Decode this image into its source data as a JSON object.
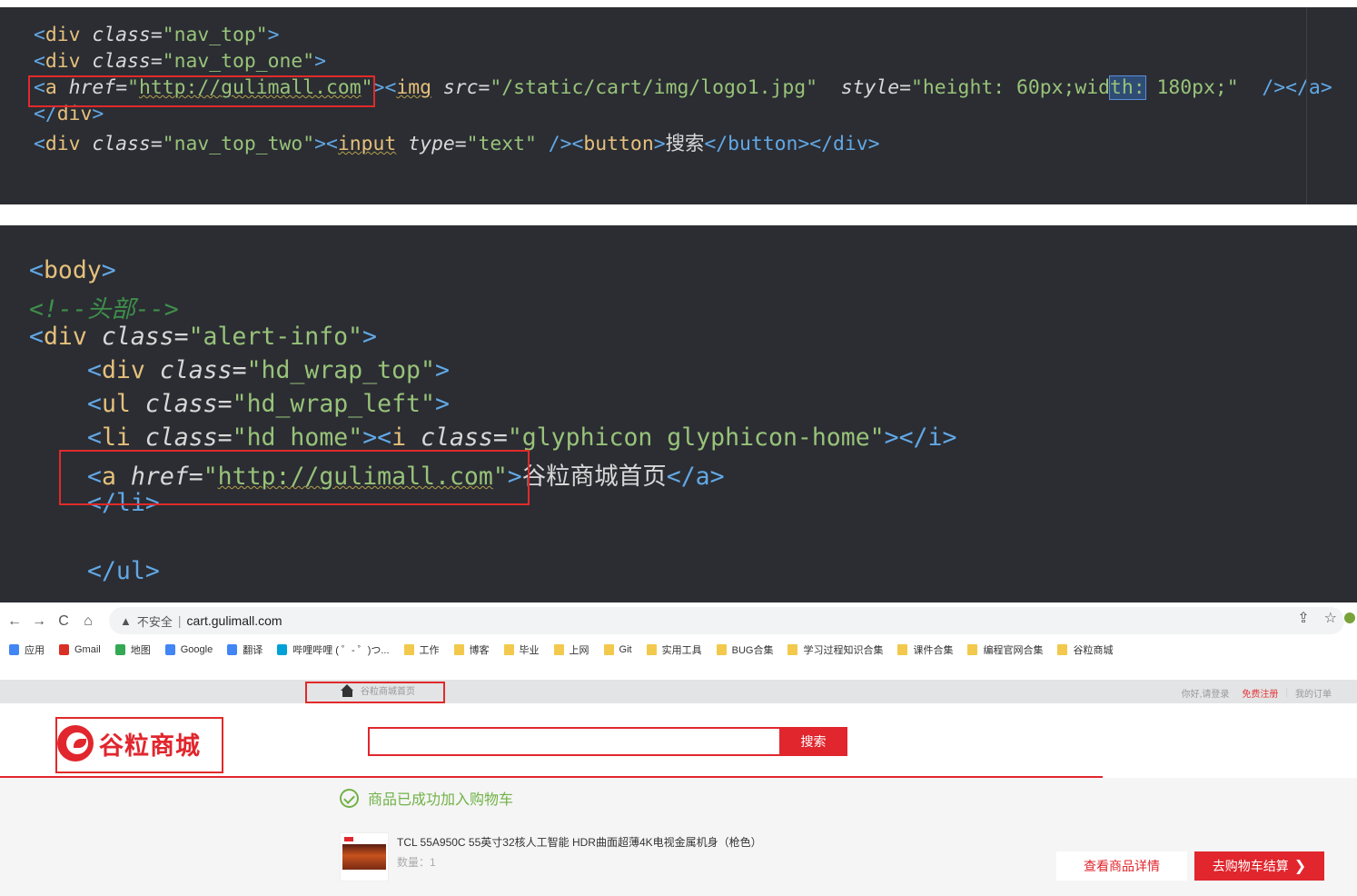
{
  "editor1": {
    "l1": {
      "t1": "<",
      "tag": "div",
      "attr": "class",
      "eq": "=",
      "val": "\"nav_top\"",
      "t2": ">"
    },
    "l2": {
      "t1": "<",
      "tag": "div",
      "attr": "class",
      "eq": "=",
      "val": "\"nav_top_one\"",
      "t2": ">"
    },
    "l3": {
      "t1": "<",
      "tag_a": "a",
      "attr_href": "href",
      "eq": "=",
      "q1": "\"",
      "url": "http://gulimall.com",
      "q2": "\"",
      "gt": ">",
      "lt2": "<",
      "tag_img": "img",
      "attr_src": "src",
      "src_val": "\"/static/cart/img/logo1.jpg\"",
      "attr_style": "style",
      "style_a": "\"height: 60px;wid",
      "style_hl": "th:",
      "style_b": " 180px;\"",
      "close": "/></a>"
    },
    "l4": {
      "t1": "</",
      "tag": "div",
      "t2": ">"
    },
    "l5": {
      "t1": "<",
      "tag": "div",
      "attr": "class",
      "eq": "=",
      "val": "\"nav_top_two\"",
      "t2": ">",
      "lt2": "<",
      "tag_input": "input",
      "attr_type": "type",
      "type_val": "\"text\"",
      "mid": " /><",
      "tag_button": "button",
      "gt": ">",
      "btn_text": "搜索",
      "close_button": "</button></div>"
    }
  },
  "editor2": {
    "l1": {
      "t1": "<",
      "tag": "body",
      "t2": ">"
    },
    "l2": {
      "comment": "<!--头部-->"
    },
    "l3": {
      "t1": "<",
      "tag": "div",
      "attr": "class",
      "eq": "=",
      "val": "\"alert-info\"",
      "t2": ">"
    },
    "l4": {
      "t1": "<",
      "tag": "div",
      "attr": "class",
      "eq": "=",
      "val": "\"hd_wrap_top\"",
      "t2": ">"
    },
    "l5": {
      "t1": "<",
      "tag": "ul",
      "attr": "class",
      "eq": "=",
      "val": "\"hd_wrap_left\"",
      "t2": ">"
    },
    "l6": {
      "t1": "<",
      "tag": "li",
      "attr": "class",
      "eq": "=",
      "val": "\"hd_home\"",
      "t2": "><",
      "tag_i": "i",
      "attr_i": "class",
      "val_i": "\"glyphicon glyphicon-home\"",
      "close_i": "></i>"
    },
    "l7": {
      "t1": "<",
      "tag": "a",
      "attr": "href",
      "eq": "=",
      "q1": "\"",
      "url": "http://gulimall.com",
      "q2": "\"",
      "gt": ">",
      "text": "谷粒商城首页",
      "close": "</a>"
    },
    "l8": {
      "close": "</li>"
    },
    "l9": {
      "close": "</ul>"
    }
  },
  "browser": {
    "nav": {
      "back": "←",
      "forward": "→",
      "reload": "C",
      "home": "⌂"
    },
    "address": {
      "warning": "▲",
      "insecure": "不安全",
      "sep": "|",
      "url": "cart.gulimall.com"
    },
    "actions": {
      "share": "⇪",
      "star": "☆"
    },
    "bookmarks": [
      "应用",
      "Gmail",
      "地图",
      "Google",
      "翻译",
      "哔哩哔哩 ( ゜- ゜)つ...",
      "工作",
      "博客",
      "毕业",
      "上网",
      "Git",
      "实用工具",
      "BUG合集",
      "学习过程知识合集",
      "课件合集",
      "编程官网合集",
      "谷粒商城"
    ]
  },
  "site": {
    "home_link": "谷粒商城首页",
    "greeting": "你好,请登录",
    "register": "免费注册",
    "orders": "我的订单",
    "divider": "|",
    "logo_text": "谷粒商城",
    "search_button": "搜索",
    "success_message": "商品已成功加入购物车",
    "product_name": "TCL 55A950C 55英寸32核人工智能 HDR曲面超薄4K电视金属机身（枪色）",
    "product_qty": "数量：1",
    "view_detail": "查看商品详情",
    "checkout": "去购物车结算",
    "checkout_arrow": "❯"
  },
  "colors": {
    "brand_red": "#e1262d",
    "success_green": "#71b247",
    "editor_bg": "#2b2d33"
  }
}
